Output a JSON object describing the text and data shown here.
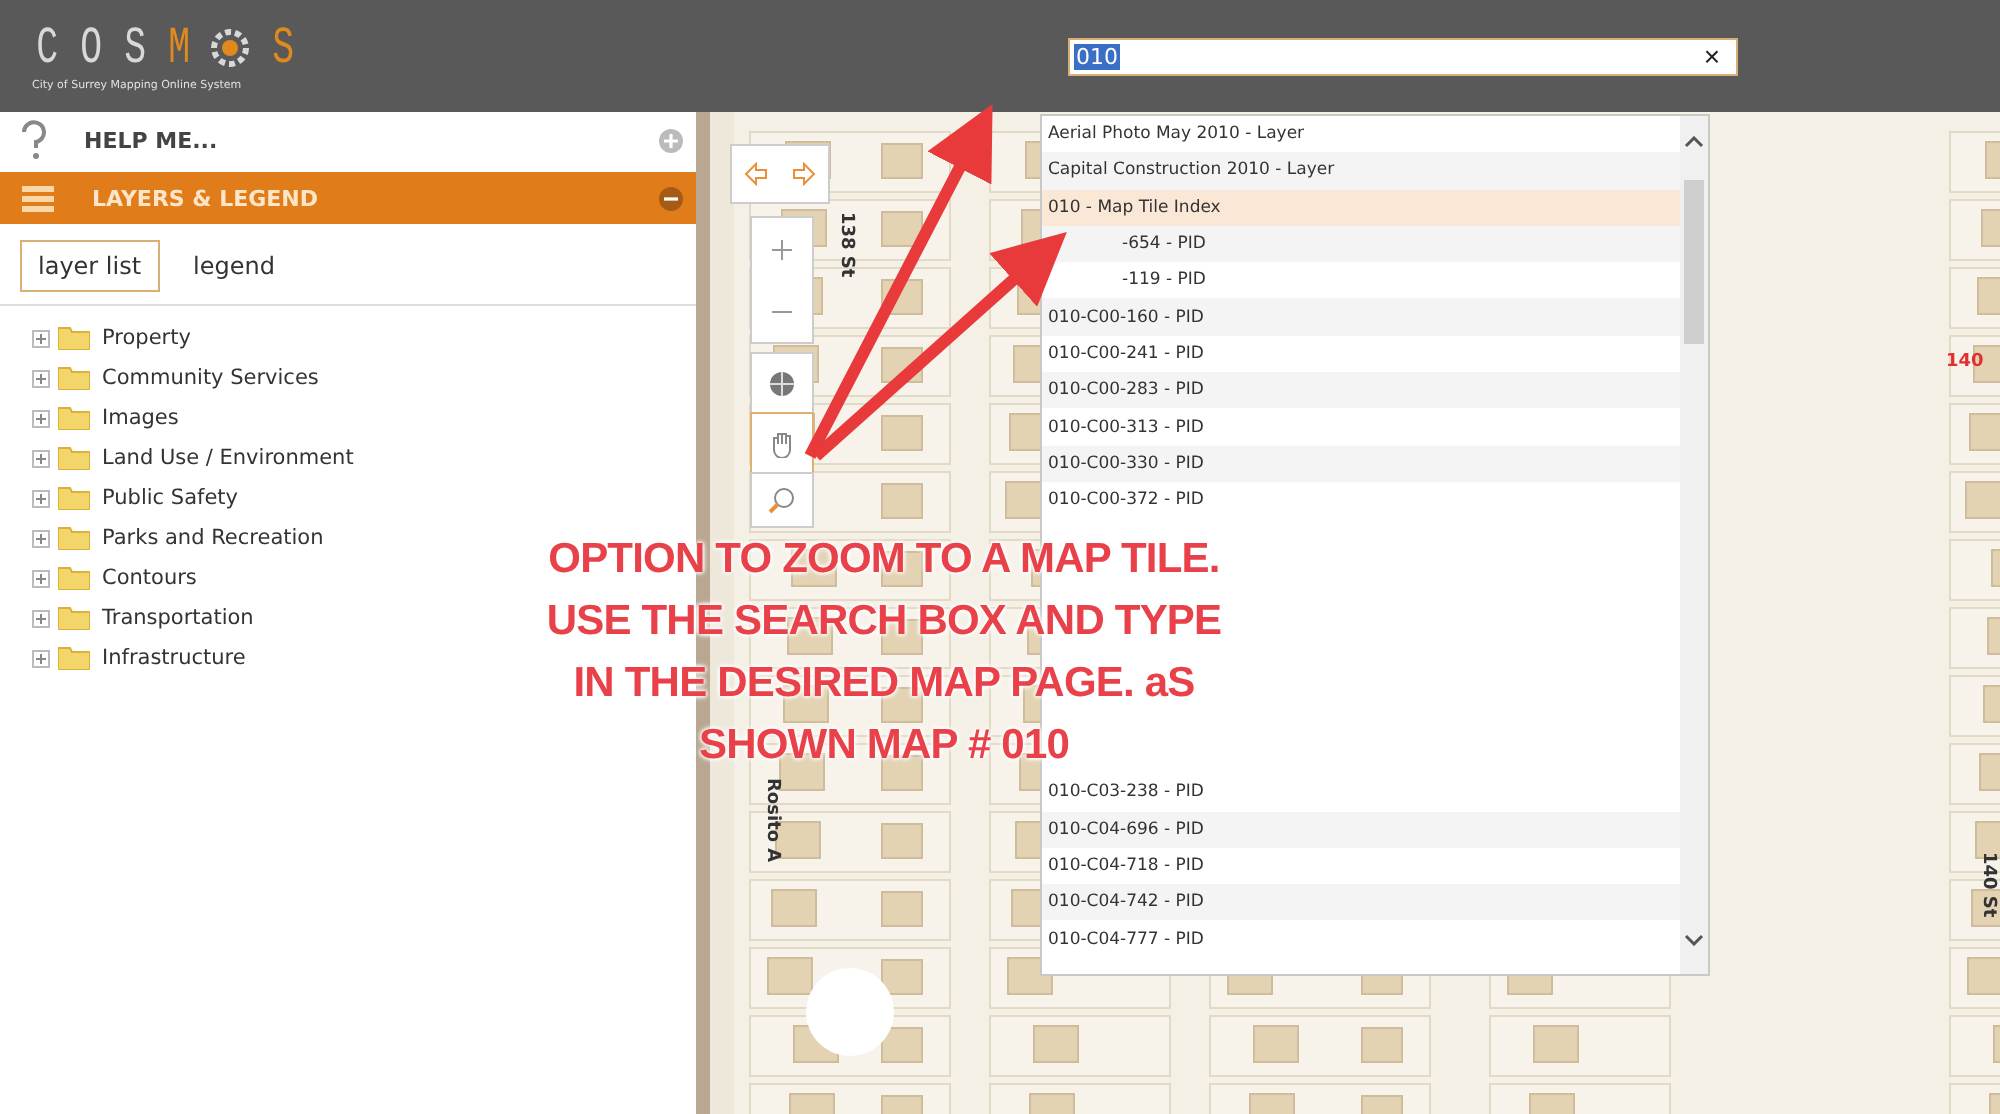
{
  "logo": {
    "letters": [
      {
        "kind": "letter",
        "text": "C",
        "accent": false
      },
      {
        "kind": "letter",
        "text": "O",
        "accent": false
      },
      {
        "kind": "letter",
        "text": "S",
        "accent": false
      },
      {
        "kind": "letter",
        "text": "M",
        "accent": true
      },
      {
        "kind": "gear"
      },
      {
        "kind": "letter",
        "text": "S",
        "accent": true
      }
    ],
    "subtitle": "City of Surrey Mapping Online System"
  },
  "search": {
    "value": "010",
    "clear": "×"
  },
  "sidebar": {
    "panels": [
      {
        "kind": "help",
        "title": "HELP ME...",
        "expanded": false
      },
      {
        "kind": "layers",
        "title": "LAYERS & LEGEND",
        "expanded": true
      }
    ],
    "tabs": [
      {
        "label": "layer list",
        "selected": true
      },
      {
        "label": "legend",
        "selected": false
      }
    ],
    "layers": [
      {
        "label": "Property",
        "expanded": false
      },
      {
        "label": "Community Services",
        "expanded": false
      },
      {
        "label": "Images",
        "expanded": false
      },
      {
        "label": "Land Use / Environment",
        "expanded": false
      },
      {
        "label": "Public Safety",
        "expanded": false
      },
      {
        "label": "Parks and Recreation",
        "expanded": false
      },
      {
        "label": "Contours",
        "expanded": false
      },
      {
        "label": "Transportation",
        "expanded": false
      },
      {
        "label": "Infrastructure",
        "expanded": false
      }
    ]
  },
  "map": {
    "street_labels": [
      {
        "text": "138 St",
        "kind": "vertical"
      },
      {
        "text": "Rosito A",
        "kind": "vertical"
      },
      {
        "text": "140 St",
        "kind": "vertical"
      },
      {
        "text": "140",
        "kind": "address"
      }
    ]
  },
  "results_top": [
    {
      "label": "Aerial Photo May 2010 - Layer",
      "selected": false
    },
    {
      "label": "Capital Construction 2010 - Layer",
      "selected": false
    },
    {
      "label": "010 - Map Tile Index",
      "selected": true
    },
    {
      "label": "-654 - PID",
      "selected": false,
      "kind": "partial"
    },
    {
      "label": "-119 - PID",
      "selected": false,
      "kind": "partial"
    },
    {
      "label": "010-C00-160 - PID",
      "selected": false
    },
    {
      "label": "010-C00-241 - PID",
      "selected": false
    },
    {
      "label": "010-C00-283 - PID",
      "selected": false
    },
    {
      "label": "010-C00-313 - PID",
      "selected": false
    },
    {
      "label": "010-C00-330 - PID",
      "selected": false
    },
    {
      "label": "010-C00-372 - PID",
      "selected": false
    }
  ],
  "results_bottom": [
    {
      "label": "010-C03-238 - PID",
      "selected": false
    },
    {
      "label": "010-C04-696 - PID",
      "selected": false
    },
    {
      "label": "010-C04-718 - PID",
      "selected": false
    },
    {
      "label": "010-C04-742 - PID",
      "selected": false
    },
    {
      "label": "010-C04-777 - PID",
      "selected": false
    }
  ],
  "annotation": {
    "lines": [
      "OPTION TO ZOOM TO A MAP TILE.",
      "USE THE SEARCH BOX AND TYPE",
      "IN THE DESIRED MAP PAGE. aS",
      "SHOWN MAP # 010"
    ]
  }
}
